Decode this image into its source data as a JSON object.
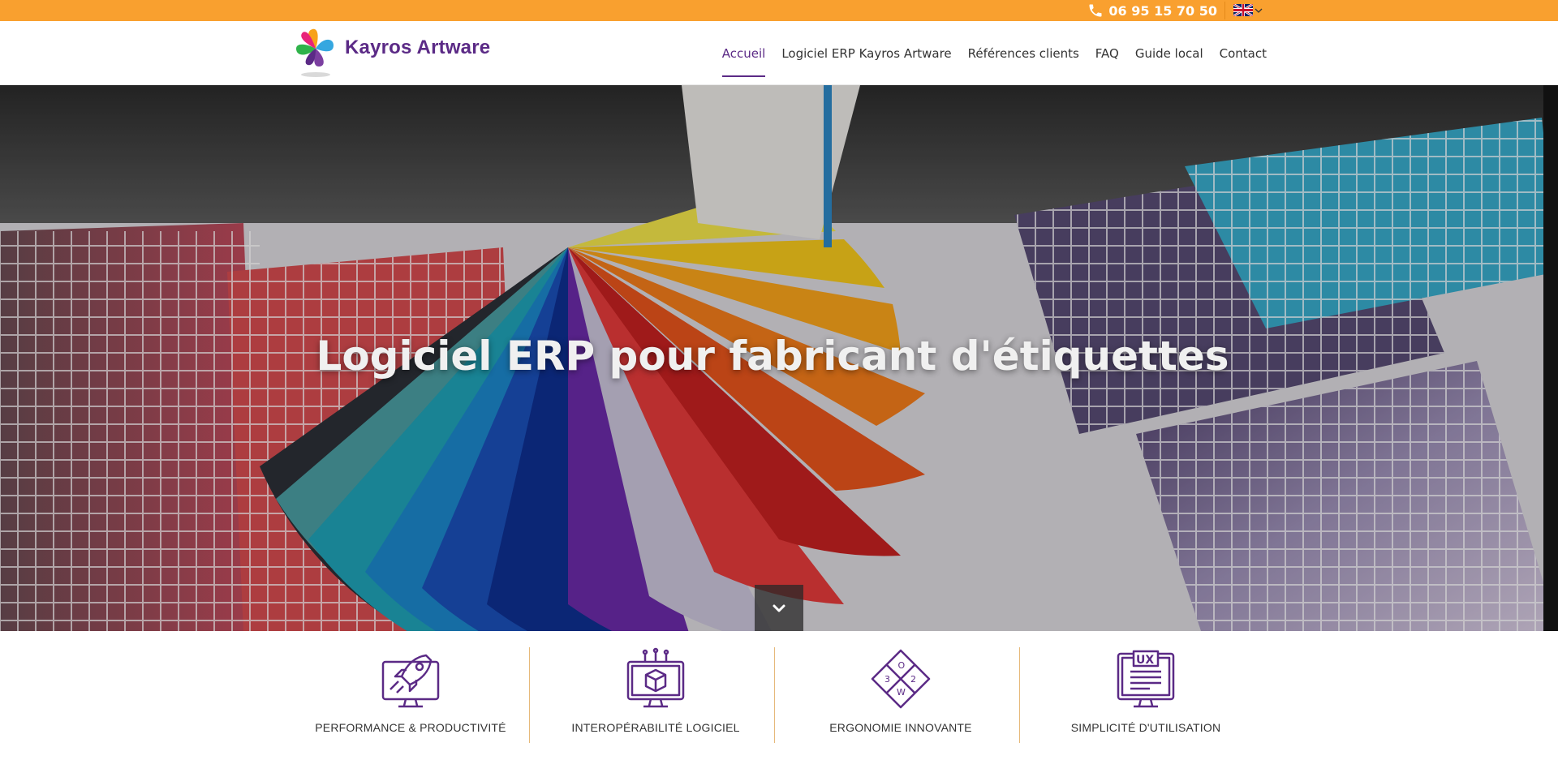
{
  "topbar": {
    "phone": "06 95 15 70 50",
    "phone_icon": "phone-icon",
    "language_flag": "uk-flag-icon",
    "language_chevron": "chevron-down-icon",
    "background_color": "#f9a02f"
  },
  "header": {
    "logo_text": "Kayros Artware",
    "logo_icon": "flower-logo-icon",
    "brand_color": "#5b2a86",
    "nav": [
      {
        "label": "Accueil",
        "active": true
      },
      {
        "label": "Logiciel ERP Kayros Artware",
        "active": false
      },
      {
        "label": "Références clients",
        "active": false
      },
      {
        "label": "FAQ",
        "active": false
      },
      {
        "label": "Guide local",
        "active": false
      },
      {
        "label": "Contact",
        "active": false
      }
    ]
  },
  "hero": {
    "title": "Logiciel ERP pour fabricant d'étiquettes",
    "background": "color-swatch-fan-photo",
    "scroll_icon": "chevron-down-icon"
  },
  "features": [
    {
      "label": "PERFORMANCE & PRODUCTIVITÉ",
      "icon": "rocket-monitor-icon"
    },
    {
      "label": "INTEROPÉRABILITÉ LOGICIEL",
      "icon": "cube-monitor-icon"
    },
    {
      "label": "ERGONOMIE INNOVANTE",
      "icon": "diamond-compass-icon"
    },
    {
      "label": "SIMPLICITÉ D'UTILISATION",
      "icon": "ux-monitor-icon"
    }
  ],
  "colors": {
    "accent": "#5b2a86",
    "topbar": "#f9a02f",
    "separator": "#e6b97a"
  }
}
